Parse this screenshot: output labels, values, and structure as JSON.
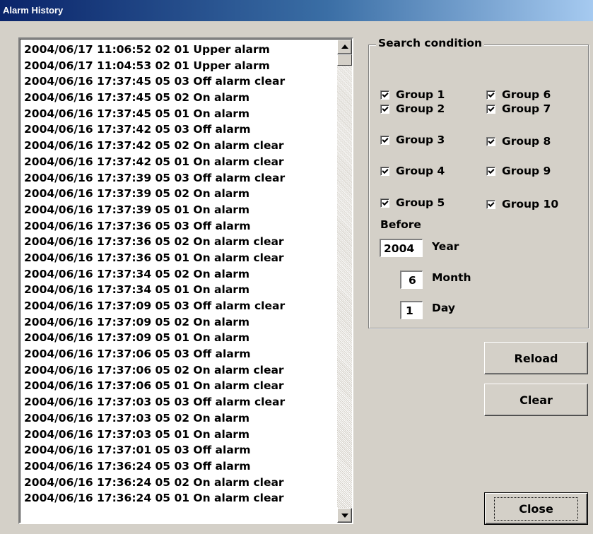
{
  "window": {
    "title": "Alarm History"
  },
  "alarm_list": {
    "items": [
      "2004/06/17 11:06:52 02 01 Upper alarm",
      "2004/06/17 11:04:53 02 01 Upper alarm",
      "2004/06/16 17:37:45 05 03 Off alarm clear",
      "2004/06/16 17:37:45 05 02 On alarm",
      "2004/06/16 17:37:45 05 01 On alarm",
      "2004/06/16 17:37:42 05 03 Off alarm",
      "2004/06/16 17:37:42 05 02 On alarm clear",
      "2004/06/16 17:37:42 05 01 On alarm clear",
      "2004/06/16 17:37:39 05 03 Off alarm clear",
      "2004/06/16 17:37:39 05 02 On alarm",
      "2004/06/16 17:37:39 05 01 On alarm",
      "2004/06/16 17:37:36 05 03 Off alarm",
      "2004/06/16 17:37:36 05 02 On alarm clear",
      "2004/06/16 17:37:36 05 01 On alarm clear",
      "2004/06/16 17:37:34 05 02 On alarm",
      "2004/06/16 17:37:34 05 01 On alarm",
      "2004/06/16 17:37:09 05 03 Off alarm clear",
      "2004/06/16 17:37:09 05 02 On alarm",
      "2004/06/16 17:37:09 05 01 On alarm",
      "2004/06/16 17:37:06 05 03 Off alarm",
      "2004/06/16 17:37:06 05 02 On alarm clear",
      "2004/06/16 17:37:06 05 01 On alarm clear",
      "2004/06/16 17:37:03 05 03 Off alarm clear",
      "2004/06/16 17:37:03 05 02 On alarm",
      "2004/06/16 17:37:03 05 01 On alarm",
      "2004/06/16 17:37:01 05 03 Off alarm",
      "2004/06/16 17:36:24 05 03 Off alarm",
      "2004/06/16 17:36:24 05 02 On alarm clear",
      "2004/06/16 17:36:24 05 01 On alarm clear"
    ]
  },
  "search": {
    "legend": "Search condition",
    "groups": [
      {
        "label": "Group 1",
        "checked": true
      },
      {
        "label": "Group 2",
        "checked": true
      },
      {
        "label": "Group 3",
        "checked": true
      },
      {
        "label": "Group 4",
        "checked": true
      },
      {
        "label": "Group 5",
        "checked": true
      },
      {
        "label": "Group 6",
        "checked": true
      },
      {
        "label": "Group 7",
        "checked": true
      },
      {
        "label": "Group 8",
        "checked": true
      },
      {
        "label": "Group 9",
        "checked": true
      },
      {
        "label": "Group 10",
        "checked": true
      }
    ],
    "before_label": "Before",
    "year_value": "2004",
    "year_label": "Year",
    "month_value": "6",
    "month_label": "Month",
    "day_value": "1",
    "day_label": "Day"
  },
  "buttons": {
    "reload": "Reload",
    "clear": "Clear",
    "close": "Close"
  },
  "colors": {
    "titlebar_start": "#0a246a",
    "titlebar_end": "#a6caf0",
    "dialog_face": "#d4d0c8"
  }
}
